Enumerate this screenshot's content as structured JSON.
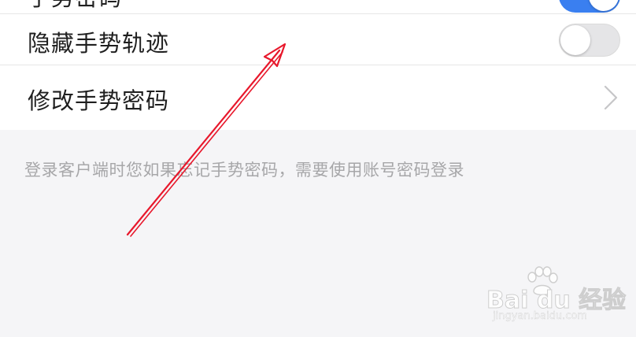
{
  "settings": {
    "top_row_label": "手势密码",
    "hide_trail_label": "隐藏手势轨迹",
    "modify_label": "修改手势密码"
  },
  "hint": {
    "text": "登录客户端时您如果忘记手势密码，需要使用账号密码登录"
  },
  "toggles": {
    "top_row": "on",
    "hide_trail": "off"
  },
  "colors": {
    "accent": "#3a7ff0",
    "annotation": "#e8182c",
    "background": "#f5f5f7"
  },
  "watermark": {
    "logo_text": "Bai du 经验",
    "url_text": "jingyan.baidu.com"
  }
}
